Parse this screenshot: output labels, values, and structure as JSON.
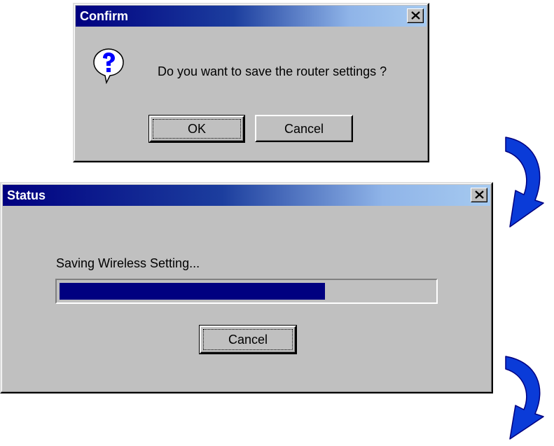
{
  "confirm_dialog": {
    "title": "Confirm",
    "icon": "question-icon",
    "message": "Do you want to save the router settings ?",
    "ok_label": "OK",
    "cancel_label": "Cancel"
  },
  "status_dialog": {
    "title": "Status",
    "message": "Saving Wireless Setting...",
    "progress": 0.71,
    "cancel_label": "Cancel"
  },
  "colors": {
    "window_face": "#c0c0c0",
    "titlebar_start": "#000080",
    "titlebar_end": "#a6caf0",
    "progress_fill": "#000080",
    "arrow": "#0a3bd8"
  },
  "annotations": {
    "arrow_icon": "curved-down-arrow-icon"
  }
}
